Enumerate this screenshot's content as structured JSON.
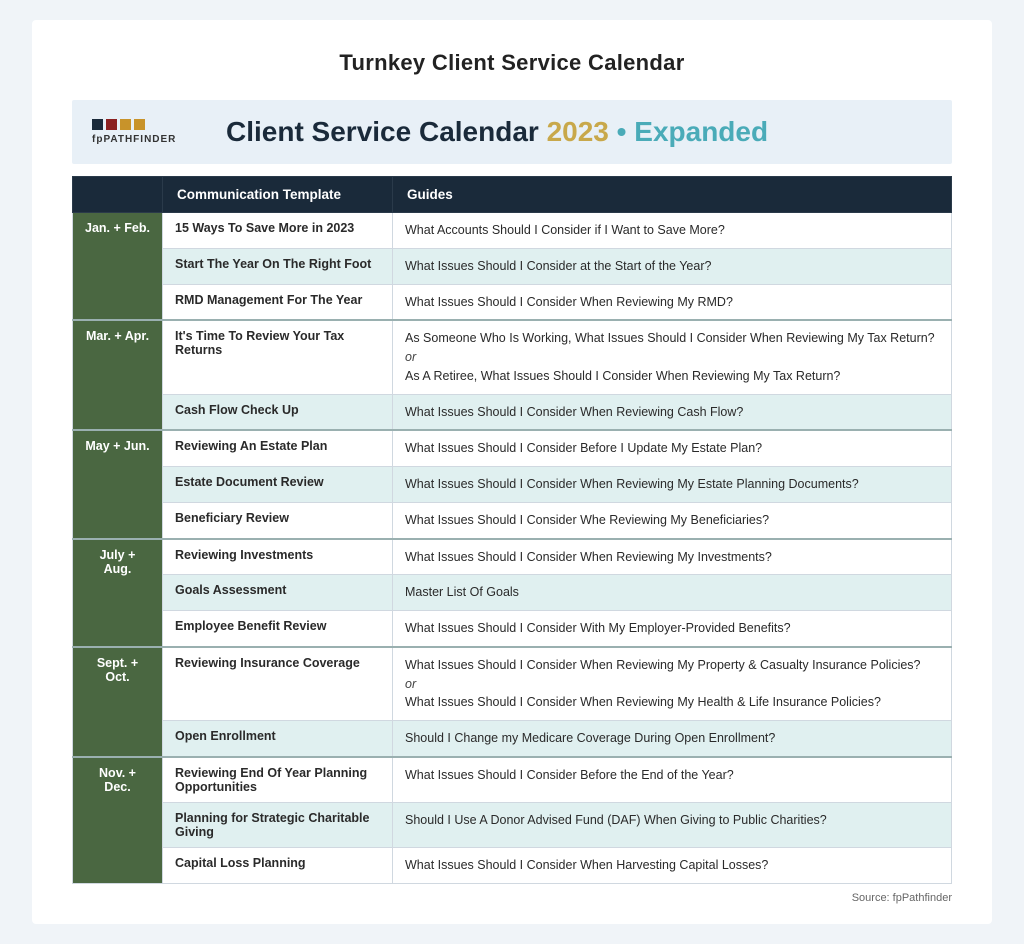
{
  "page": {
    "title": "Turnkey Client Service Calendar",
    "source": "Source: fpPathfinder"
  },
  "header": {
    "logo_text": "fpPATHFINDER",
    "heading_part1": "Client Service Calendar",
    "heading_year": "2023",
    "heading_bullet": "•",
    "heading_expanded": "Expanded"
  },
  "table": {
    "col1": "Communication Template",
    "col2": "Guides",
    "sections": [
      {
        "month": "Jan. + Feb.",
        "color": "#4a6741",
        "rows": [
          {
            "template": "15 Ways To Save More in 2023",
            "guide": "What Accounts Should I Consider if I Want to Save More?"
          },
          {
            "template": "Start The Year On The Right Foot",
            "guide": "What Issues Should I Consider at the Start of the Year?"
          },
          {
            "template": "RMD Management For The Year",
            "guide": "What Issues Should I Consider When Reviewing My RMD?"
          }
        ]
      },
      {
        "month": "Mar. + Apr.",
        "color": "#4a6741",
        "rows": [
          {
            "template": "It's Time To Review Your Tax Returns",
            "guide": "As Someone Who Is Working, What Issues Should I Consider When Reviewing My Tax Return?\nor\nAs A Retiree, What Issues Should I Consider When Reviewing My Tax Return?"
          },
          {
            "template": "Cash Flow Check Up",
            "guide": "What Issues Should I Consider When Reviewing Cash Flow?"
          }
        ]
      },
      {
        "month": "May + Jun.",
        "color": "#4a6741",
        "rows": [
          {
            "template": "Reviewing An Estate Plan",
            "guide": "What Issues Should I Consider Before I Update My Estate Plan?"
          },
          {
            "template": "Estate Document Review",
            "guide": "What Issues Should I Consider When Reviewing My Estate Planning Documents?"
          },
          {
            "template": "Beneficiary Review",
            "guide": "What Issues Should I Consider Whe Reviewing My Beneficiaries?"
          }
        ]
      },
      {
        "month": "July + Aug.",
        "color": "#4a6741",
        "rows": [
          {
            "template": "Reviewing Investments",
            "guide": "What Issues Should I Consider When Reviewing My Investments?"
          },
          {
            "template": "Goals Assessment",
            "guide": "Master List Of Goals"
          },
          {
            "template": "Employee Benefit Review",
            "guide": "What Issues Should I Consider With My Employer-Provided Benefits?"
          }
        ]
      },
      {
        "month": "Sept. + Oct.",
        "color": "#4a6741",
        "rows": [
          {
            "template": "Reviewing Insurance Coverage",
            "guide": "What Issues Should I Consider When Reviewing My Property & Casualty Insurance Policies?\nor\nWhat Issues Should I Consider When Reviewing My Health & Life Insurance Policies?"
          },
          {
            "template": "Open Enrollment",
            "guide": "Should I Change my Medicare Coverage During Open Enrollment?"
          }
        ]
      },
      {
        "month": "Nov. + Dec.",
        "color": "#4a6741",
        "rows": [
          {
            "template": "Reviewing End Of Year Planning Opportunities",
            "guide": "What Issues Should I Consider Before the End of the Year?"
          },
          {
            "template": "Planning for Strategic Charitable Giving",
            "guide": "Should I Use A Donor Advised Fund (DAF) When Giving to Public Charities?"
          },
          {
            "template": "Capital Loss Planning",
            "guide": "What Issues Should I Consider When Harvesting Capital Losses?"
          }
        ]
      }
    ]
  }
}
